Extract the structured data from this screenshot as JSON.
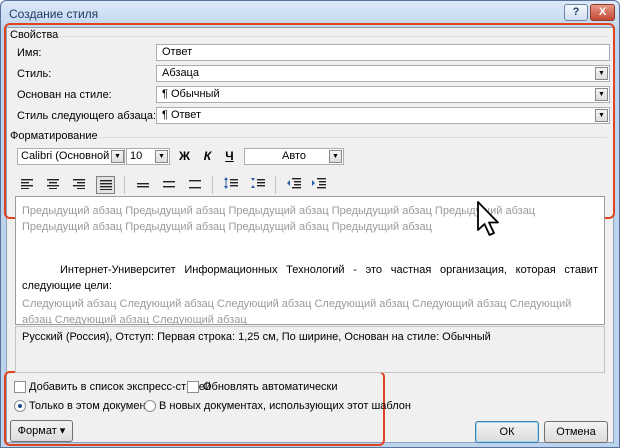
{
  "window": {
    "title": "Создание стиля",
    "help_label": "?",
    "close_label": "X"
  },
  "properties": {
    "section_label": "Свойства",
    "name_label": "Имя:",
    "name_value": "Ответ",
    "style_label": "Стиль:",
    "style_value": "Абзаца",
    "based_on_label": "Основан на стиле:",
    "based_on_value": "¶ Обычный",
    "next_style_label": "Стиль следующего абзаца:",
    "next_style_value": "¶ Ответ"
  },
  "formatting": {
    "section_label": "Форматирование",
    "font_value": "Calibri (Основной тек",
    "size_value": "10",
    "bold_label": "Ж",
    "italic_label": "К",
    "underline_label": "Ч",
    "color_value": "Авто"
  },
  "preview": {
    "previous_paragraph": "Предыдущий абзац Предыдущий абзац Предыдущий абзац Предыдущий абзац Предыдущий абзац Предыдущий абзац Предыдущий абзац Предыдущий абзац Предыдущий абзац",
    "current_paragraph": "Интернет-Университет Информационных Технологий - это частная организация, которая ставит следующие цели:",
    "next_paragraph": "Следующий абзац Следующий абзац Следующий абзац Следующий абзац Следующий абзац Следующий абзац Следующий абзац Следующий абзац"
  },
  "description": "Русский (Россия), Отступ: Первая строка:  1,25 см, По ширине, Основан на стиле: Обычный",
  "options": {
    "add_to_quick_styles": "Добавить в список экспресс-стилей",
    "auto_update": "Обновлять автоматически",
    "only_this_document": "Только в этом документе",
    "new_documents_template": "В новых документах, использующих этот шаблон"
  },
  "buttons": {
    "format_label": "Формат ▾",
    "ok_label": "ОК",
    "cancel_label": "Отмена"
  },
  "colors": {
    "highlight_border": "#e0441f",
    "title_bar": "#c4d8f1"
  }
}
